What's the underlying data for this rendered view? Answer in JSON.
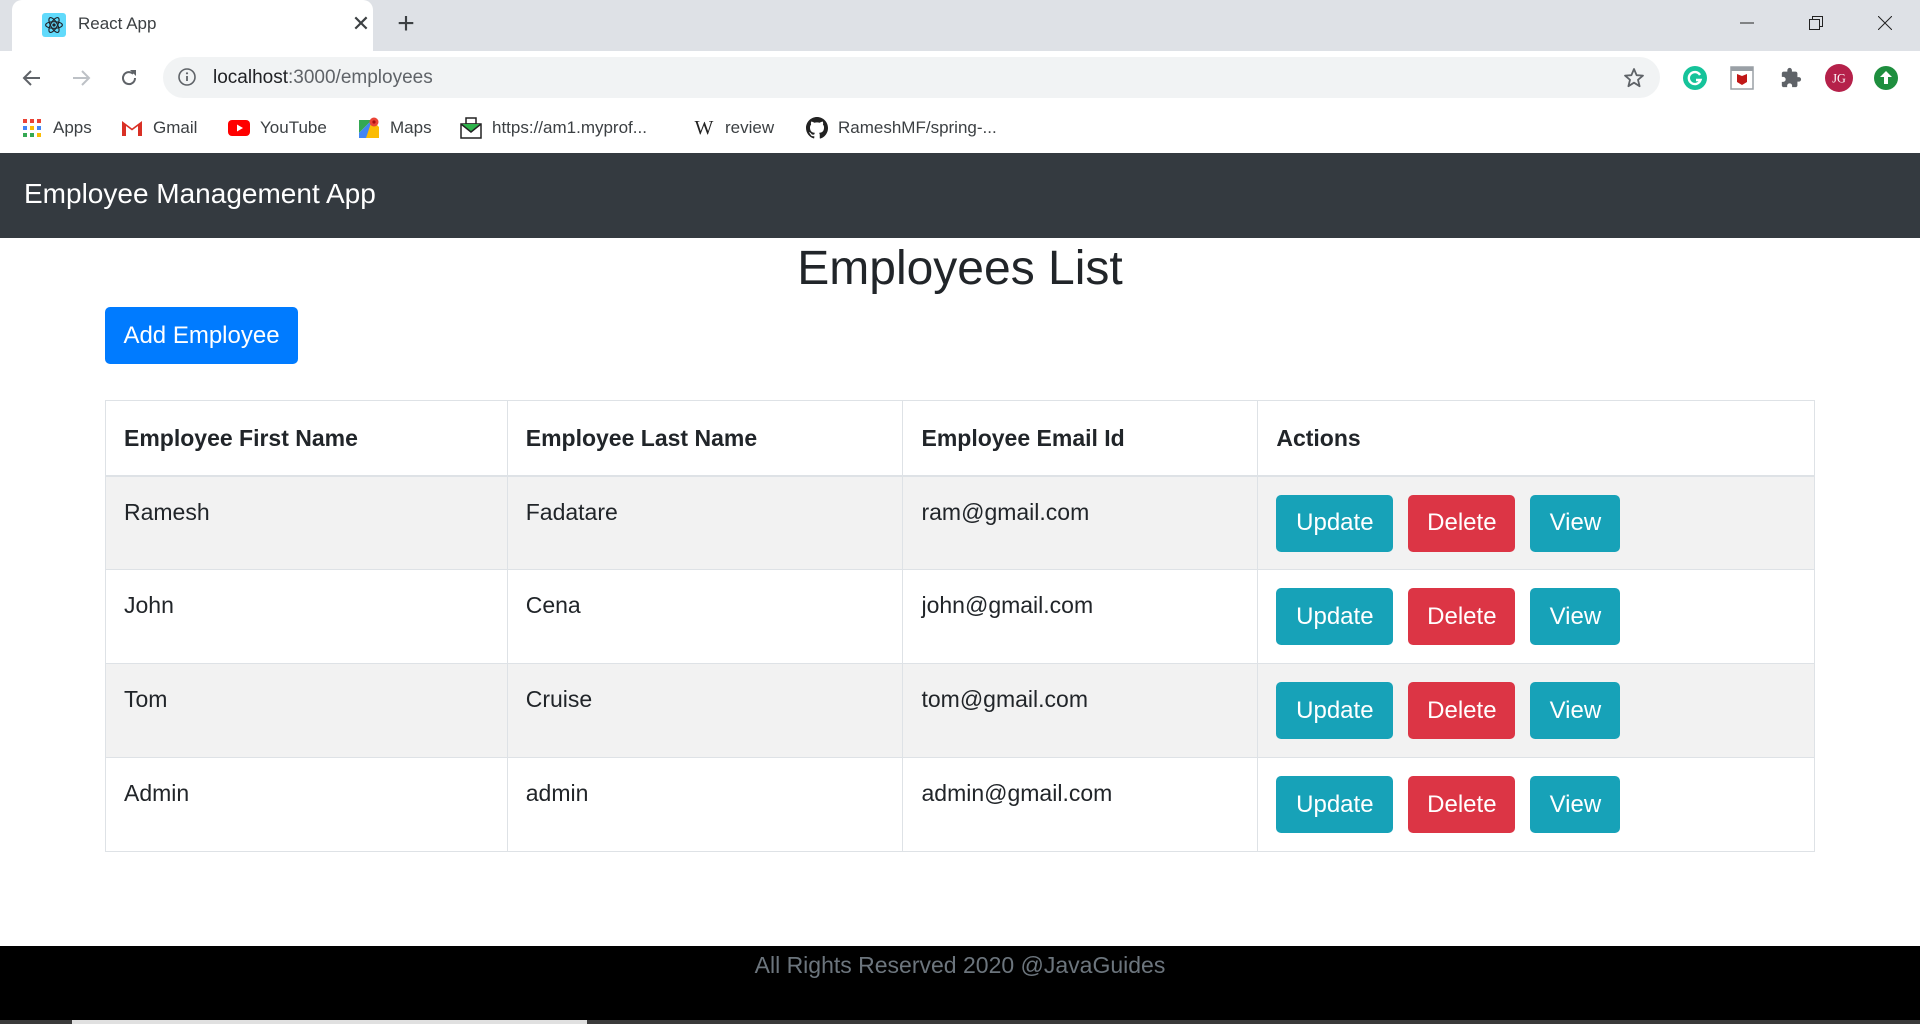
{
  "browser": {
    "tab_title": "React App",
    "url_host": "localhost",
    "url_rest": ":3000/employees",
    "bookmarks": [
      {
        "label": "Apps",
        "icon": "apps-grid-icon"
      },
      {
        "label": "Gmail",
        "icon": "gmail-icon"
      },
      {
        "label": "YouTube",
        "icon": "youtube-icon"
      },
      {
        "label": "Maps",
        "icon": "maps-icon"
      },
      {
        "label": "https://am1.myprof...",
        "icon": "mail-envelope-icon"
      },
      {
        "label": "review",
        "icon": "wikipedia-icon"
      },
      {
        "label": "RameshMF/spring-...",
        "icon": "github-icon"
      }
    ],
    "extensions": [
      "grammarly-icon",
      "mcafee-icon",
      "puzzle-extensions-icon",
      "profile-avatar-icon",
      "update-arrow-icon"
    ]
  },
  "app": {
    "brand": "Employee Management App",
    "page_title": "Employees List",
    "add_button": "Add Employee",
    "table": {
      "headers": [
        "Employee First Name",
        "Employee Last Name",
        "Employee Email Id",
        "Actions"
      ],
      "rows": [
        {
          "first": "Ramesh",
          "last": "Fadatare",
          "email": "ram@gmail.com"
        },
        {
          "first": "John",
          "last": "Cena",
          "email": "john@gmail.com"
        },
        {
          "first": "Tom",
          "last": "Cruise",
          "email": "tom@gmail.com"
        },
        {
          "first": "Admin",
          "last": "admin",
          "email": "admin@gmail.com"
        }
      ],
      "actions": {
        "update": "Update",
        "delete": "Delete",
        "view": "View"
      }
    },
    "footer": "All Rights Reserved 2020 @JavaGuides"
  },
  "colors": {
    "navbar": "#343a40",
    "primary": "#007bff",
    "info": "#17a2b8",
    "danger": "#dc3545",
    "footer_bg": "#000000",
    "footer_text": "#6c757d"
  }
}
